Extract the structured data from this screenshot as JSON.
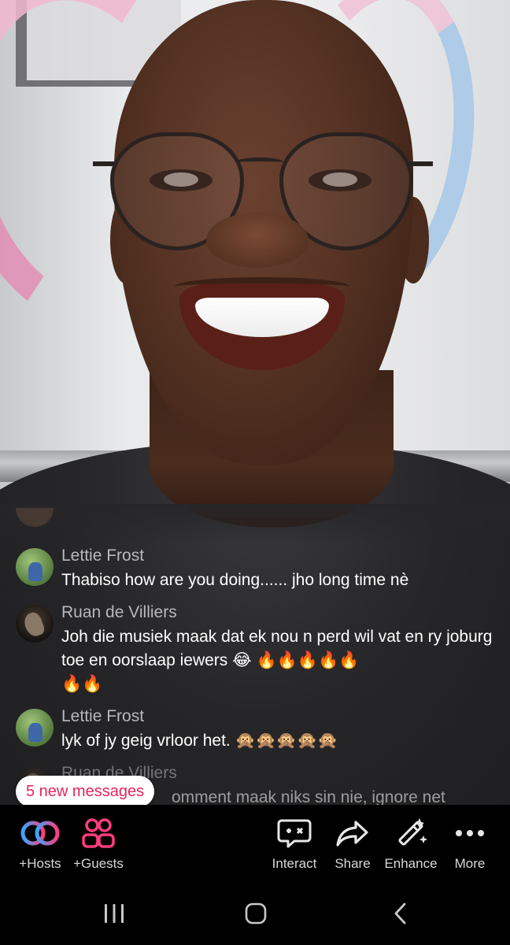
{
  "chat": {
    "messages": [
      {
        "sender": "Lettie Frost",
        "text": "Thabiso how are you doing...... jho long time nè",
        "avatar": "green"
      },
      {
        "sender": "Ruan de Villiers",
        "text": "Joh die musiek maak dat ek nou n perd wil vat en ry joburg toe en oorslaap iewers 😂 🔥🔥🔥🔥🔥",
        "continuation": "🔥🔥",
        "avatar": "dark"
      },
      {
        "sender": "Lettie Frost",
        "text": "lyk of jy geig vrloor het. 🙊🙊🙊🙊🙊",
        "avatar": "green"
      },
      {
        "sender": "Ruan de Villiers",
        "text": "omment maak niks sin nie, ignore net",
        "avatar": "dark"
      }
    ],
    "new_messages_label": "5 new messages"
  },
  "toolbar": {
    "hosts_label": "+Hosts",
    "guests_label": "+Guests",
    "interact_label": "Interact",
    "share_label": "Share",
    "enhance_label": "Enhance",
    "more_label": "More"
  },
  "icons": {
    "hosts": "link-rings-icon",
    "guests": "people-icon",
    "interact": "chat-gamepad-icon",
    "share": "share-arrow-icon",
    "enhance": "magic-wand-icon",
    "more": "more-dots-icon",
    "recents": "recents-icon",
    "home": "home-icon",
    "back": "back-icon"
  },
  "colors": {
    "accent": "#e8245c",
    "hosts_gradient_start": "#3ba4ff",
    "hosts_gradient_end": "#ff3d7f",
    "chat_sender": "#b9b9bb",
    "chat_text": "#ffffff"
  }
}
